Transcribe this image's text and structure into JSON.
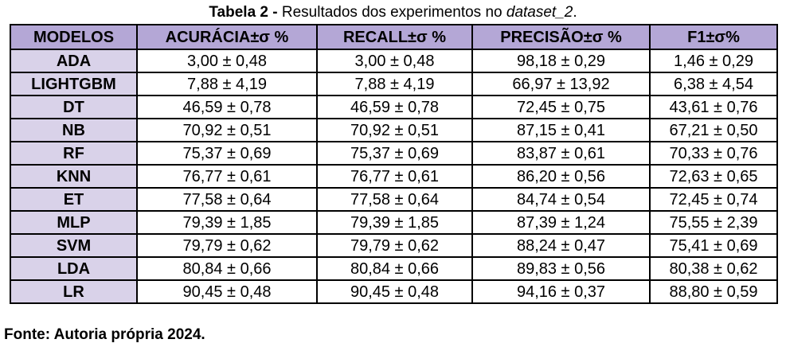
{
  "caption": {
    "label": "Tabela 2 -",
    "text_main": " Resultados dos experimentos no ",
    "text_italic": "dataset_2",
    "text_end": "."
  },
  "colors": {
    "header_bg": "#b4a7d6",
    "model_bg": "#d9d2e9",
    "border": "#000000"
  },
  "table": {
    "headers": [
      "MODELOS",
      "ACURÁCIA±σ %",
      "RECALL±σ %",
      "PRECISÃO±σ %",
      "F1±σ%"
    ],
    "rows": [
      [
        "ADA",
        "3,00 ± 0,48",
        "3,00 ± 0,48",
        "98,18 ± 0,29",
        "1,46 ± 0,29"
      ],
      [
        "LIGHTGBM",
        "7,88 ± 4,19",
        "7,88 ± 4,19",
        "66,97 ± 13,92",
        "6,38 ± 4,54"
      ],
      [
        "DT",
        "46,59 ± 0,78",
        "46,59 ± 0,78",
        "72,45 ± 0,75",
        "43,61 ± 0,76"
      ],
      [
        "NB",
        "70,92 ± 0,51",
        "70,92 ± 0,51",
        "87,15 ± 0,41",
        "67,21 ± 0,50"
      ],
      [
        "RF",
        "75,37 ± 0,69",
        "75,37 ± 0,69",
        "83,87 ± 0,61",
        "70,33 ± 0,76"
      ],
      [
        "KNN",
        "76,77 ± 0,61",
        "76,77 ± 0,61",
        "86,20 ± 0,56",
        "72,63 ± 0,65"
      ],
      [
        "ET",
        "77,58 ± 0,64",
        "77,58 ± 0,64",
        "84,74 ± 0,54",
        "72,45 ± 0,74"
      ],
      [
        "MLP",
        "79,39 ± 1,85",
        "79,39 ± 1,85",
        "87,39 ± 1,24",
        "75,55 ± 2,39"
      ],
      [
        "SVM",
        "79,79 ± 0,62",
        "79,79 ± 0,62",
        "88,24 ± 0,47",
        "75,41 ± 0,69"
      ],
      [
        "LDA",
        "80,84 ± 0,66",
        "80,84 ± 0,66",
        "89,83 ± 0,56",
        "80,38 ± 0,62"
      ],
      [
        "LR",
        "90,45 ± 0,48",
        "90,45 ± 0,48",
        "94,16 ± 0,37",
        "88,80 ± 0,59"
      ]
    ]
  },
  "footer": {
    "text": "Fonte: Autoria própria 2024."
  }
}
